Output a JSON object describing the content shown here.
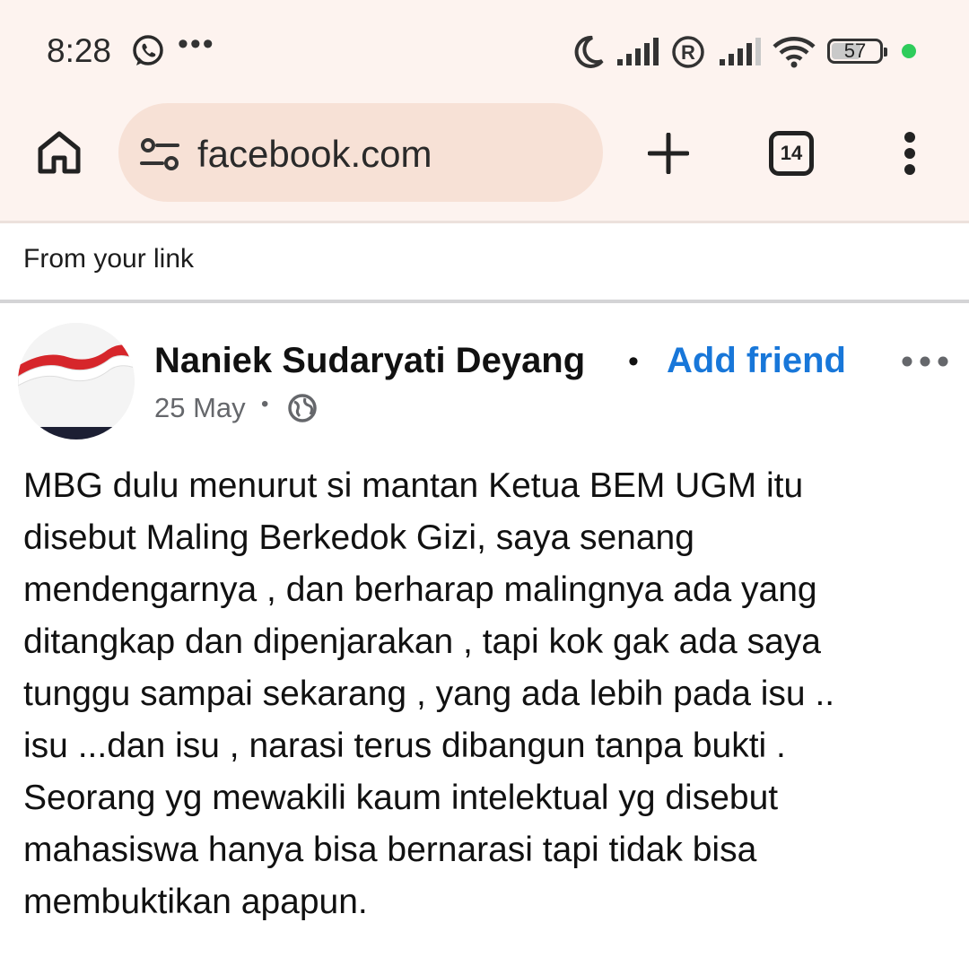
{
  "status_bar": {
    "time": "8:28",
    "battery_percent": "57",
    "battery_level": 0.57,
    "icons": [
      "whatsapp-icon",
      "moon-icon",
      "signal-icon",
      "roaming-icon",
      "signal-icon",
      "wifi-icon",
      "battery-icon"
    ],
    "indicator_color": "#2ecc5b"
  },
  "browser": {
    "url": "facebook.com",
    "tab_count": "14",
    "toolbar_bg": "#fdf3ef",
    "url_bar_bg": "#f7e1d6"
  },
  "banner": {
    "text": "From your link"
  },
  "post": {
    "author": "Naniek Sudaryati Deyang",
    "separator": "•",
    "add_friend_label": "Add friend",
    "date": "25 May",
    "date_separator": "•",
    "audience_icon": "globe-icon",
    "body": "MBG dulu menurut si mantan Ketua BEM UGM itu\ndisebut Maling Berkedok Gizi, saya senang\nmendengarnya , dan berharap malingnya ada yang\nditangkap dan dipenjarakan , tapi kok gak ada saya\ntunggu sampai sekarang , yang ada lebih pada isu ..\nisu ...dan isu , narasi terus dibangun  tanpa bukti .\nSeorang yg mewakili kaum intelektual yg disebut\nmahasiswa hanya bisa bernarasi tapi tidak bisa\nmembuktikan apapun.",
    "accent_color": "#1877d9"
  }
}
